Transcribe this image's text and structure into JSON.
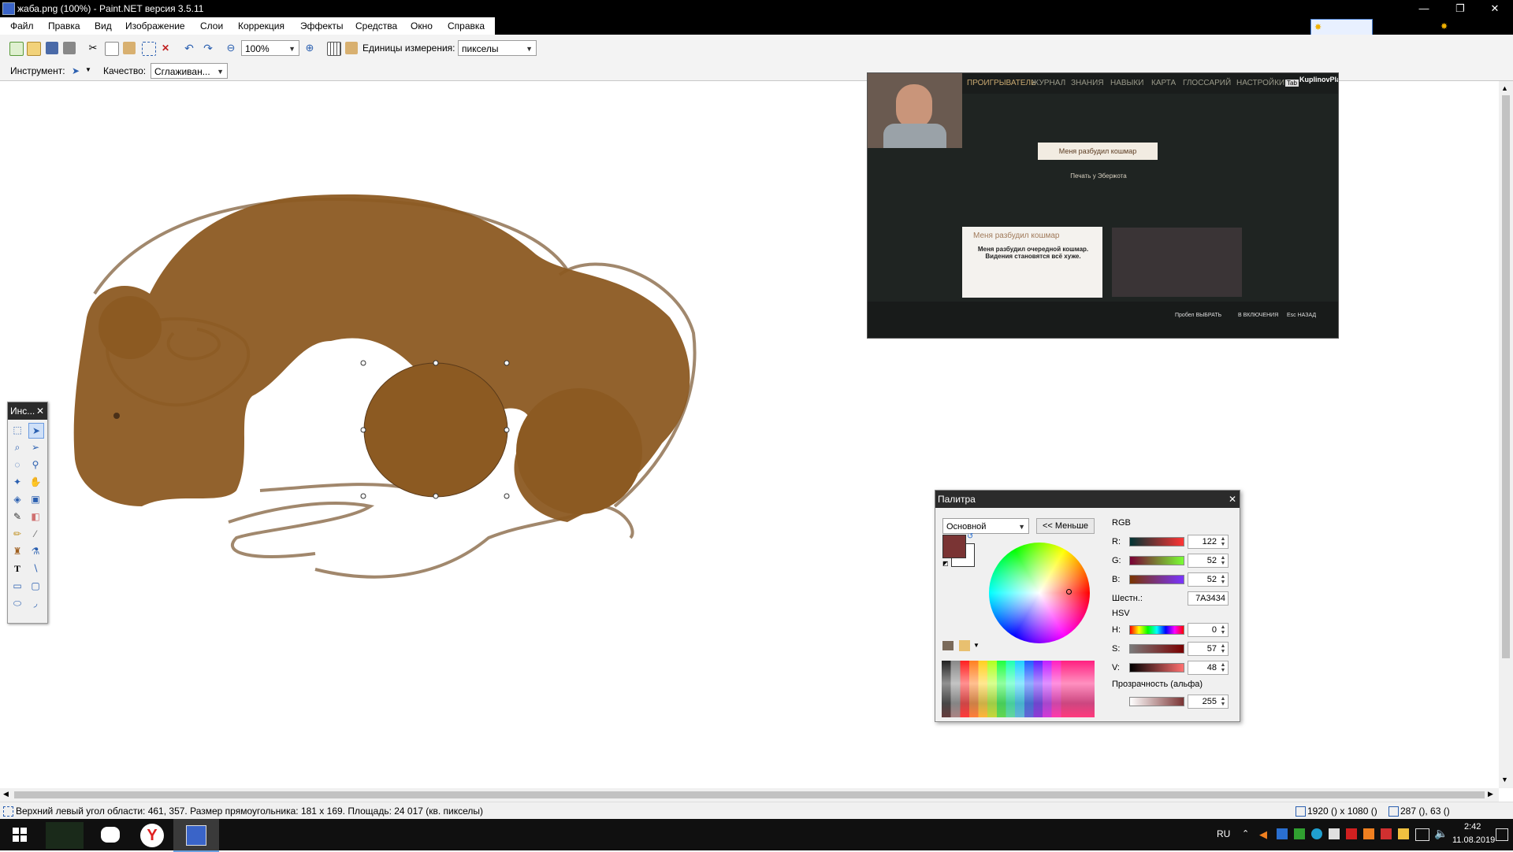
{
  "window": {
    "title": "жаба.png (100%) - Paint.NET версия 3.5.11",
    "controls": [
      "—",
      "❐",
      "✕"
    ]
  },
  "menu": [
    "Файл",
    "Правка",
    "Вид",
    "Изображение",
    "Слои",
    "Коррекция",
    "Эффекты",
    "Средства",
    "Окно",
    "Справка"
  ],
  "toolbar": {
    "zoom_value": "100%",
    "units_label": "Единицы измерения:",
    "units_value": "пикселы"
  },
  "toolbar2": {
    "tool_label": "Инструмент:",
    "quality_label": "Качество:",
    "quality_value": "Сглаживан..."
  },
  "tools_window": {
    "title": "Инс..."
  },
  "game_overlay": {
    "menu_items": [
      "ПРОИГРЫВАТЕЛЬ",
      "ЖУРНАЛ",
      "ЗНАНИЯ",
      "НАВЫКИ",
      "КАРТА",
      "ГЛОССАРИЙ",
      "НАСТРОЙКИ"
    ],
    "tab_badge": "Tab",
    "logo": "KuplinovPlay",
    "top_banner": "Меня разбудил кошмар",
    "subtitle": "Печать у Эбержота",
    "card_title": "Меня разбудил кошмар",
    "card_text": "Меня разбудил очередной кошмар. Видения становятся всё хуже.",
    "footer": [
      "Пробел ВЫБРАТЬ",
      "В ВКЛЮЧЕНИЯ",
      "Esc НАЗАД"
    ]
  },
  "palette": {
    "title": "Палитра",
    "mode_select": "Основной",
    "less_button": "<< Меньше",
    "rgb_label": "RGB",
    "r_label": "R:",
    "g_label": "G:",
    "b_label": "B:",
    "r": "122",
    "g": "52",
    "b": "52",
    "hex_label": "Шестн.:",
    "hex": "7A3434",
    "hsv_label": "HSV",
    "h_label": "H:",
    "s_label": "S:",
    "v_label": "V:",
    "h": "0",
    "s": "57",
    "v": "48",
    "alpha_label": "Прозрачность (альфа)",
    "alpha": "255",
    "primary_color": "#7a3434",
    "secondary_color": "#ffffff"
  },
  "status": {
    "selection_info": "Верхний левый угол области: 461, 357. Размер прямоугольника: 181 x 169. Площадь: 24 017 (кв. пикселы)",
    "image_size": "1920 () x 1080 ()",
    "cursor_pos": "287 (), 63 ()"
  },
  "taskbar": {
    "lang": "RU",
    "time": "2:42",
    "date": "11.08.2019"
  },
  "colors": {
    "toad_fill": "#8c5a22",
    "toad_outline": "#7a5a3a"
  }
}
